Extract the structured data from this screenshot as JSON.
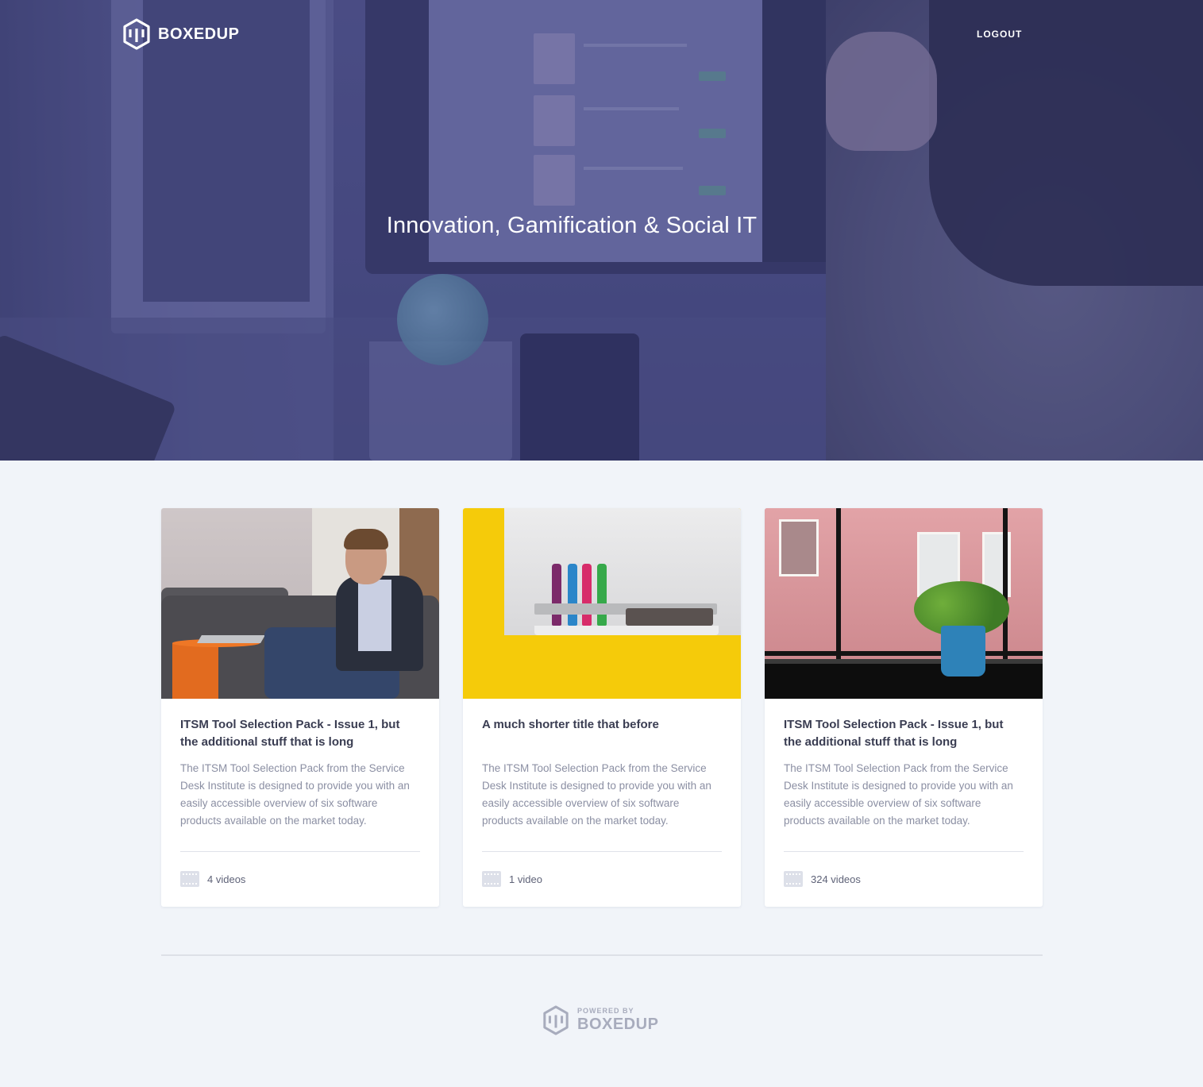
{
  "header": {
    "brand": "BOXEDUP",
    "logout_label": "LOGOUT",
    "logo_icon": "boxedup-hexagon-icon"
  },
  "hero": {
    "title": "Innovation, Gamification & Social IT"
  },
  "cards": [
    {
      "title": "ITSM Tool Selection Pack - Issue 1, but the additional stuff that is long",
      "description": "The ITSM Tool Selection Pack from the Service Desk Institute is designed to provide you with an easily accessible overview of six software products available on the market today.",
      "count": "4 videos",
      "icon": "film-icon"
    },
    {
      "title": "A much shorter title that before",
      "description": "The ITSM Tool Selection Pack from the Service Desk Institute is designed to provide you with an easily accessible overview of six software products available on the market today.",
      "count": "1 video",
      "icon": "film-icon"
    },
    {
      "title": "ITSM Tool Selection Pack - Issue 1, but the additional stuff that is long",
      "description": "The ITSM Tool Selection Pack from the Service Desk Institute is designed to provide you with an easily accessible overview of six software products available on the market today.",
      "count": "324 videos",
      "icon": "film-icon"
    }
  ],
  "footer": {
    "powered_by": "POWERED BY",
    "brand": "BOXEDUP"
  },
  "colors": {
    "hero_overlay": "#484a8a",
    "page_background": "#f1f4f9",
    "card_title": "#3a3d52",
    "card_text": "#8b8fa3",
    "footer_logo": "#a8acbd"
  }
}
